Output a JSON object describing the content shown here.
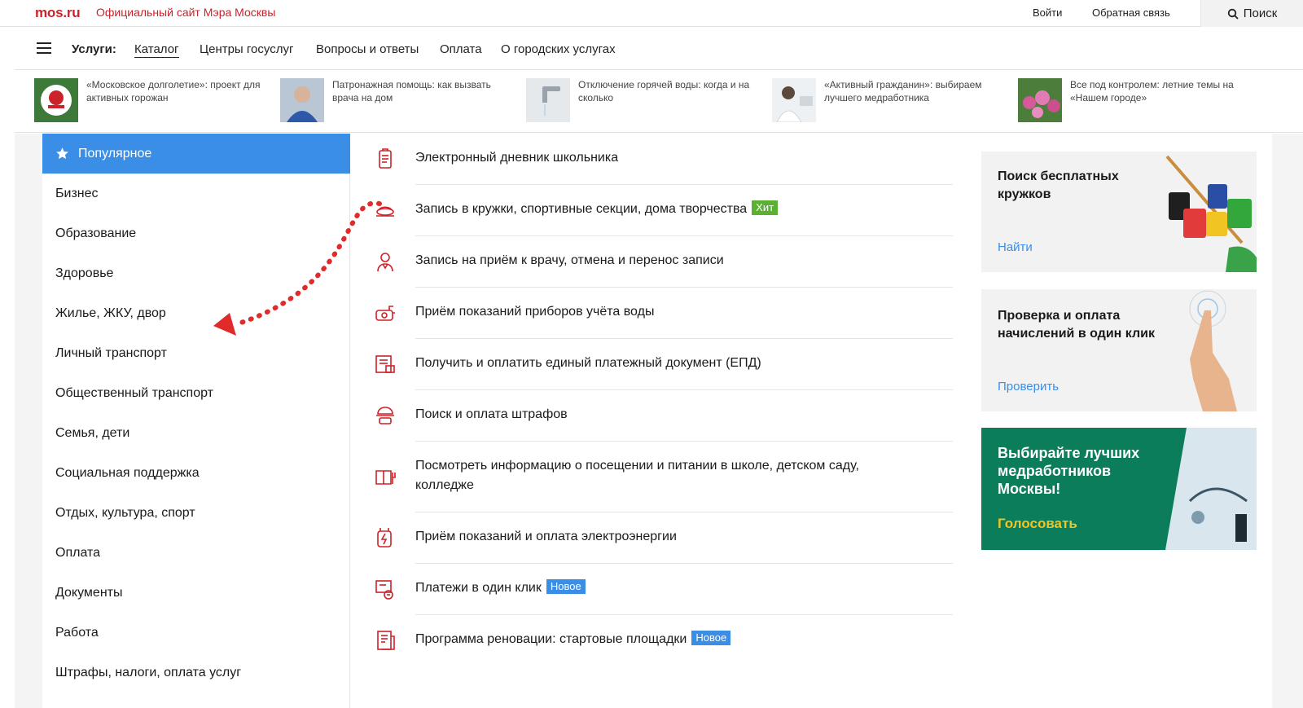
{
  "header": {
    "logo": "mos.ru",
    "site_title": "Официальный сайт Мэра Москвы",
    "login": "Войти",
    "feedback": "Обратная связь",
    "search": "Поиск"
  },
  "nav": {
    "label": "Услуги:",
    "items": [
      "Каталог",
      "Центры госуслуг",
      "Вопросы и ответы",
      "Оплата",
      "О городских услугах"
    ]
  },
  "news": [
    {
      "text": "«Московское долголетие»: проект для активных горожан"
    },
    {
      "text": "Патронажная помощь: как вызвать врача на дом"
    },
    {
      "text": "Отключение горячей воды: когда и на сколько"
    },
    {
      "text": "«Активный гражданин»: выбираем лучшего медработника"
    },
    {
      "text": "Все под контролем: летние темы на «Нашем городе»"
    }
  ],
  "sidebar": {
    "items": [
      "Популярное",
      "Бизнес",
      "Образование",
      "Здоровье",
      "Жилье, ЖКУ, двор",
      "Личный транспорт",
      "Общественный транспорт",
      "Семья, дети",
      "Социальная поддержка",
      "Отдых, культура, спорт",
      "Оплата",
      "Документы",
      "Работа",
      "Штрафы, налоги, оплата услуг"
    ]
  },
  "services": [
    {
      "text": "Электронный дневник школьника",
      "icon": "school-diary-icon"
    },
    {
      "text": "Запись в кружки, спортивные секции, дома творчества",
      "badge": "Хит",
      "icon": "clubs-icon"
    },
    {
      "text": "Запись на приём к врачу, отмена и перенос записи",
      "icon": "doctor-icon"
    },
    {
      "text": "Приём показаний приборов учёта воды",
      "icon": "water-meter-icon"
    },
    {
      "text": "Получить и оплатить единый платежный документ (ЕПД)",
      "icon": "payment-document-icon"
    },
    {
      "text": "Поиск и оплата штрафов",
      "icon": "traffic-police-icon"
    },
    {
      "text": "Посмотреть информацию о посещении и питании в школе, детском саду, колледже",
      "icon": "school-meals-icon"
    },
    {
      "text": "Приём показаний и оплата электроэнергии",
      "icon": "electricity-icon"
    },
    {
      "text": "Платежи в один клик",
      "badge": "Новое",
      "icon": "one-click-pay-icon"
    },
    {
      "text": "Программа реновации: стартовые площадки",
      "badge": "Новое",
      "icon": "renovation-icon"
    }
  ],
  "banners": [
    {
      "title": "Поиск бесплатных кружков",
      "link": "Найти"
    },
    {
      "title": "Проверка и оплата начислений в один клик",
      "link": "Проверить"
    },
    {
      "title": "Выбирайте лучших медработников Москвы!",
      "link": "Голосовать"
    }
  ],
  "colors": {
    "brand_red": "#cc2229",
    "accent_blue": "#3a8ee6",
    "hit_green": "#5ab031",
    "banner_green": "#0b7d5b",
    "vote_yellow": "#f2c423"
  }
}
